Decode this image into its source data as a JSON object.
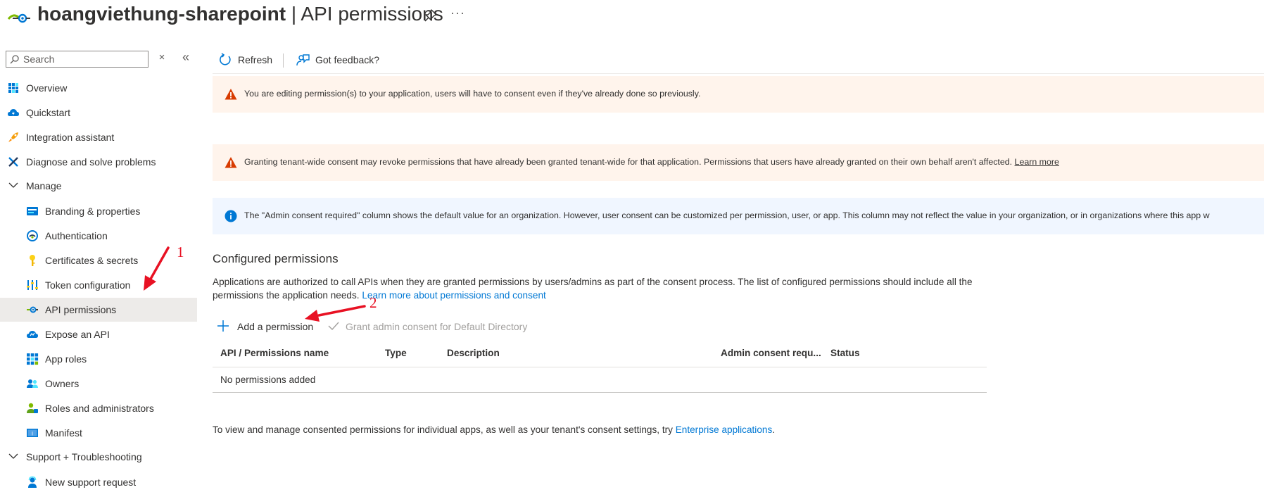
{
  "header": {
    "app_name": "hoangviethung-sharepoint",
    "separator": " | ",
    "page_name": "API permissions",
    "more_label": "···"
  },
  "sidebar": {
    "search_placeholder": "Search",
    "close_glyph": "×",
    "collapse_glyph": "«",
    "items": [
      {
        "label": "Overview",
        "icon": "overview-grid-icon"
      },
      {
        "label": "Quickstart",
        "icon": "cloud-lightning-icon"
      },
      {
        "label": "Integration assistant",
        "icon": "rocket-icon"
      },
      {
        "label": "Diagnose and solve problems",
        "icon": "tools-icon"
      },
      {
        "label": "Manage",
        "icon": "chevron-down-icon"
      },
      {
        "label": "Branding & properties",
        "icon": "branding-card-icon"
      },
      {
        "label": "Authentication",
        "icon": "authentication-icon"
      },
      {
        "label": "Certificates & secrets",
        "icon": "key-icon"
      },
      {
        "label": "Token configuration",
        "icon": "token-bars-icon"
      },
      {
        "label": "API permissions",
        "icon": "api-permissions-icon"
      },
      {
        "label": "Expose an API",
        "icon": "cloud-icon"
      },
      {
        "label": "App roles",
        "icon": "app-roles-grid-icon"
      },
      {
        "label": "Owners",
        "icon": "people-icon"
      },
      {
        "label": "Roles and administrators",
        "icon": "person-roles-icon"
      },
      {
        "label": "Manifest",
        "icon": "manifest-icon"
      },
      {
        "label": "Support + Troubleshooting",
        "icon": "chevron-down-icon"
      },
      {
        "label": "New support request",
        "icon": "support-person-icon"
      }
    ]
  },
  "toolbar": {
    "refresh_label": "Refresh",
    "feedback_label": "Got feedback?"
  },
  "banners": {
    "editing_warning": "You are editing permission(s) to your application, users will have to consent even if they've already done so previously.",
    "tenant_warning": "Granting tenant-wide consent may revoke permissions that have already been granted tenant-wide for that application. Permissions that users have already granted on their own behalf aren't affected.",
    "tenant_warning_link": "Learn more",
    "info": "The \"Admin consent required\" column shows the default value for an organization. However, user consent can be customized per permission, user, or app. This column may not reflect the value in your organization, or in organizations where this app w"
  },
  "configured": {
    "title": "Configured permissions",
    "description": "Applications are authorized to call APIs when they are granted permissions by users/admins as part of the consent process. The list of configured permissions should include all the permissions the application needs.",
    "description_link": "Learn more about permissions and consent",
    "add_permission_label": "Add a permission",
    "grant_consent_label": "Grant admin consent for Default Directory",
    "columns": [
      "API / Permissions name",
      "Type",
      "Description",
      "Admin consent requ...",
      "Status"
    ],
    "empty_text": "No permissions added"
  },
  "footer": {
    "text": "To view and manage consented permissions for individual apps, as well as your tenant's consent settings, try",
    "link": "Enterprise applications",
    "period": "."
  },
  "annotations": {
    "step1": "1",
    "step2": "2"
  },
  "colors": {
    "accent": "#0078d4",
    "warning_bg": "#fff4ec",
    "info_bg": "#f0f6ff",
    "annotation_red": "#e81123",
    "active_nav_bg": "#edebe9"
  }
}
